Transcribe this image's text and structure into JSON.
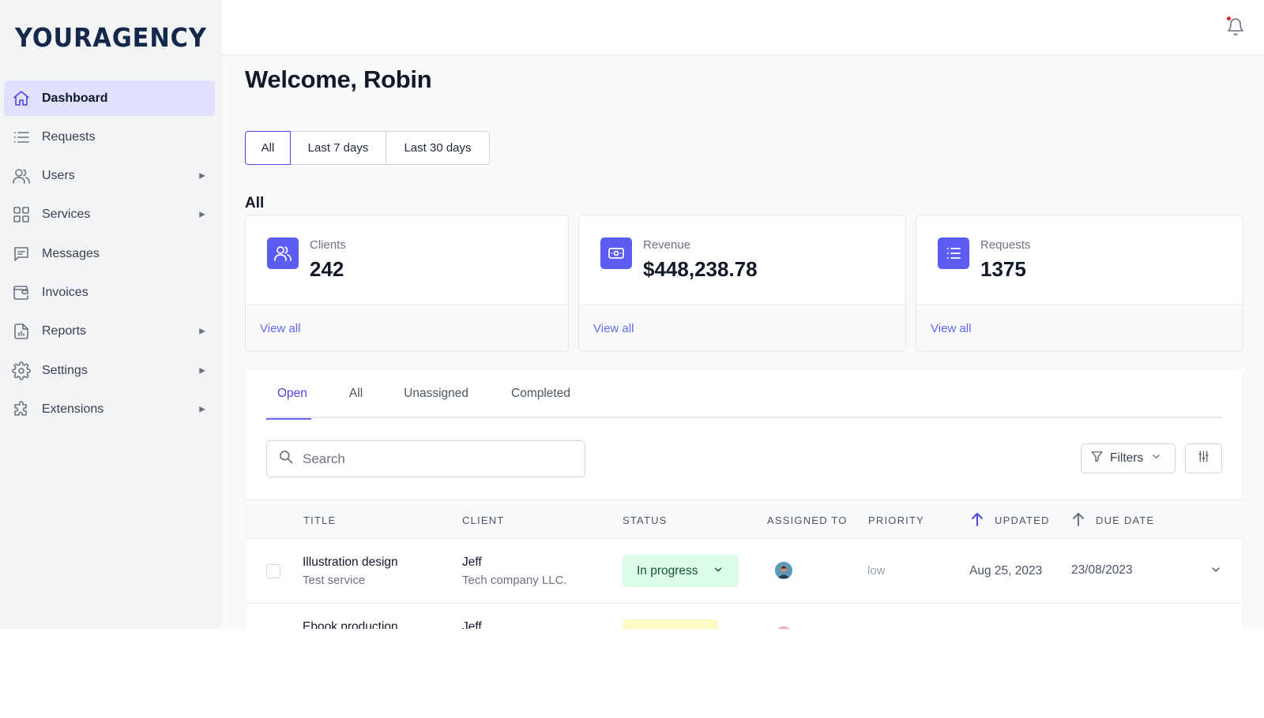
{
  "brand": {
    "logo_text": "YOURAGENCY"
  },
  "colors": {
    "accent": "#4f46e5",
    "card_icon_bg": "#5b5cf0",
    "sidebar_bg": "#f3f4f6",
    "active_nav_bg": "#e0e2fd",
    "status_green_bg": "#dcfce7",
    "status_yellow_bg": "#fef9c3"
  },
  "sidebar": {
    "items": [
      {
        "label": "Dashboard",
        "icon": "home-icon",
        "active": true,
        "has_submenu": false
      },
      {
        "label": "Requests",
        "icon": "list-icon",
        "active": false,
        "has_submenu": false
      },
      {
        "label": "Users",
        "icon": "users-icon",
        "active": false,
        "has_submenu": true
      },
      {
        "label": "Services",
        "icon": "grid-icon",
        "active": false,
        "has_submenu": true
      },
      {
        "label": "Messages",
        "icon": "message-icon",
        "active": false,
        "has_submenu": false
      },
      {
        "label": "Invoices",
        "icon": "wallet-icon",
        "active": false,
        "has_submenu": false
      },
      {
        "label": "Reports",
        "icon": "chart-file-icon",
        "active": false,
        "has_submenu": true
      },
      {
        "label": "Settings",
        "icon": "gear-icon",
        "active": false,
        "has_submenu": true
      },
      {
        "label": "Extensions",
        "icon": "puzzle-icon",
        "active": false,
        "has_submenu": true
      }
    ],
    "submenu_caret": "▶"
  },
  "topbar": {
    "notification_icon": "bell-icon",
    "has_unread": true
  },
  "main": {
    "title": "Welcome, Robin",
    "range_filter": {
      "options": [
        "All",
        "Last 7 days",
        "Last 30 days"
      ],
      "selected": "All"
    },
    "section_label": "All",
    "cards": [
      {
        "label": "Clients",
        "value": "242",
        "link": "View all",
        "icon": "users-icon"
      },
      {
        "label": "Revenue",
        "value": "$448,238.78",
        "link": "View all",
        "icon": "cash-icon"
      },
      {
        "label": "Requests",
        "value": "1375",
        "link": "View all",
        "icon": "list-icon"
      }
    ]
  },
  "requests_panel": {
    "tabs": [
      "Open",
      "All",
      "Unassigned",
      "Completed"
    ],
    "active_tab": "Open",
    "search": {
      "placeholder": "Search",
      "value": ""
    },
    "filters_label": "Filters",
    "columns": [
      "TITLE",
      "CLIENT",
      "STATUS",
      "ASSIGNED TO",
      "PRIORITY",
      "UPDATED",
      "DUE DATE"
    ],
    "rows": [
      {
        "title": "Illustration design",
        "service": "Test service",
        "client": "Jeff",
        "company": "Tech company LLC.",
        "status": "In progress",
        "priority": "low",
        "updated": "Aug 25, 2023",
        "due": "23/08/2023"
      },
      {
        "title": "Ebook production",
        "service": "",
        "client": "Jeff",
        "company": "",
        "status": "",
        "priority": "",
        "updated": "",
        "due": ""
      }
    ]
  }
}
